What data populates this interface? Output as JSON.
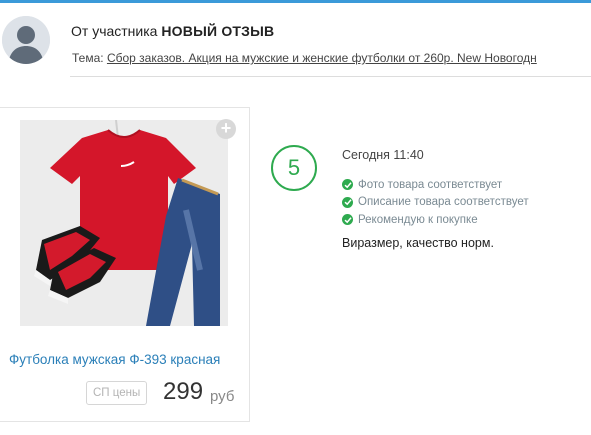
{
  "header": {
    "author_prefix": "От участника",
    "author_name": "НОВЫЙ ОТЗЫВ",
    "topic_label": "Тема:",
    "topic_link": "Сбор заказов. Акция на мужские и женские футболки от 260р. New Новогодн"
  },
  "product": {
    "title": "Футболка мужская Ф-393 красная",
    "price_tag": "СП цены",
    "price": "299",
    "currency": "руб"
  },
  "review": {
    "rating": "5",
    "date": "Сегодня 11:40",
    "checks": [
      "Фото товара соответствует",
      "Описание товара соответствует",
      "Рекомендую к покупке"
    ],
    "text": "Виразмер, качество норм."
  },
  "colors": {
    "accent": "#3b9ad9",
    "rating_green": "#2eaa4f",
    "link_blue": "#2a7fb8"
  },
  "icons": [
    "user-avatar-icon",
    "plus-icon",
    "check-icon"
  ]
}
